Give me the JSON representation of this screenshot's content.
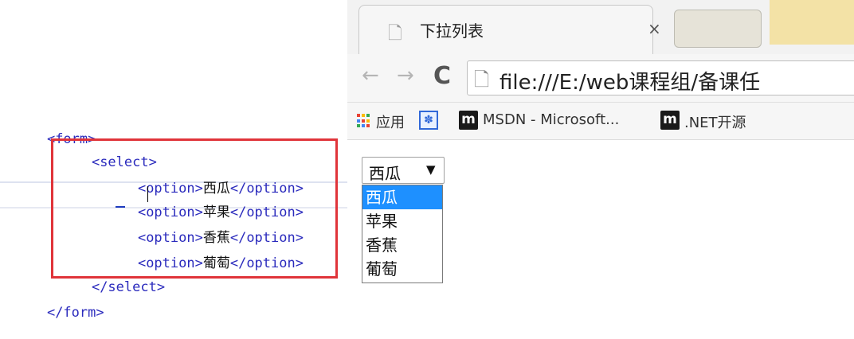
{
  "editor": {
    "lines": [
      {
        "indent": "",
        "open": "<form>",
        "text": "",
        "close": ""
      },
      {
        "indent": "    ",
        "open": "<select>",
        "text": "",
        "close": ""
      },
      {
        "indent": "        ",
        "open": "<option>",
        "text": "西瓜",
        "close": "</option>"
      },
      {
        "indent": "        ",
        "open": "<option>",
        "text": "苹果",
        "close": "</option>"
      },
      {
        "indent": "        ",
        "open": "<option>",
        "text": "香蕉",
        "close": "</option>"
      },
      {
        "indent": "        ",
        "open": "<option>",
        "text": "葡萄",
        "close": "</option>"
      },
      {
        "indent": "    ",
        "open": "</select>",
        "text": "",
        "close": ""
      },
      {
        "indent": "",
        "open": "</form>",
        "text": "",
        "close": ""
      }
    ],
    "highlight_color": "#e0343a"
  },
  "browser": {
    "tab": {
      "title": "下拉列表",
      "close_glyph": "×"
    },
    "toolbar": {
      "back": "←",
      "forward": "→",
      "reload": "C",
      "url": "file:///E:/web课程组/备课任"
    },
    "bookmarks": [
      {
        "label": "应用",
        "icon": "apps-icon"
      },
      {
        "label": "",
        "icon": "paw-icon"
      },
      {
        "label": "MSDN - Microsoft...",
        "icon": "m-icon"
      },
      {
        "label": ".NET开源",
        "icon": "m-icon"
      }
    ]
  },
  "select": {
    "value": "西瓜",
    "arrow": "▼",
    "options": [
      "西瓜",
      "苹果",
      "香蕉",
      "葡萄"
    ],
    "selected_index": 0,
    "selected_color": "#1e90ff"
  }
}
